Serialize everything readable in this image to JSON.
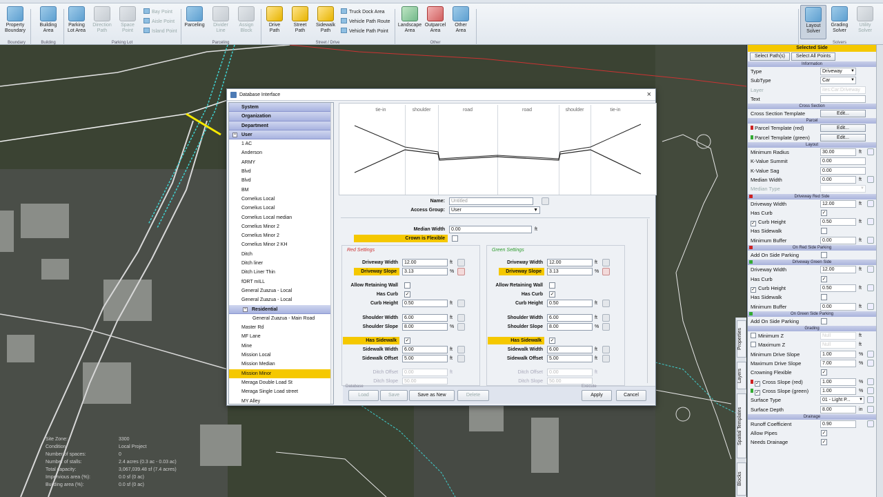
{
  "ribbon": {
    "buttons": [
      {
        "label": "Property\nBoundary",
        "state": "normal"
      },
      {
        "label": "Building\nArea",
        "state": "normal"
      },
      {
        "label": "Parking\nLot Area",
        "state": "normal"
      },
      {
        "label": "Direction\nPath",
        "state": "disabled"
      },
      {
        "label": "Space\nPoint",
        "state": "disabled"
      },
      {
        "label": "Parceling",
        "state": "normal"
      },
      {
        "label": "Divider\nLine",
        "state": "disabled"
      },
      {
        "label": "Assign\nBlock",
        "state": "disabled"
      },
      {
        "label": "Drive\nPath",
        "state": "yellow"
      },
      {
        "label": "Street\nPath",
        "state": "yellow"
      },
      {
        "label": "Sidewalk\nPath",
        "state": "yellow"
      },
      {
        "label": "Landscape\nArea",
        "state": "green"
      },
      {
        "label": "Outparcel\nArea",
        "state": "normal"
      },
      {
        "label": "Other\nArea",
        "state": "normal"
      },
      {
        "label": "Layout\nSolver",
        "state": "active"
      },
      {
        "label": "Grading\nSolver",
        "state": "normal"
      },
      {
        "label": "Utility\nSolver",
        "state": "disabled"
      }
    ],
    "small_left": [
      "Bay Point",
      "Aisle Point",
      "Island Point"
    ],
    "small_right": [
      "Truck Dock Area",
      "Vehicle Path Route",
      "Vehicle Path Point"
    ],
    "groups": [
      "Boundary",
      "Building",
      "Parking Lot",
      "Parceling",
      "Street / Drive",
      "Other",
      "Solvers"
    ]
  },
  "map": {
    "info_labels": [
      "Site Zone:",
      "Condition:",
      "Number of spaces:",
      "Number of stalls:",
      "Total capacity:",
      "Impervious area (%):",
      "Building area (%):"
    ],
    "info_values": [
      "3300",
      "Local Project",
      "0",
      "2.4 acres (0.3 ac - 0.03 ac)",
      "3,067,039.48 sf (7.4 acres)",
      "0.0 sf (0 ac)",
      "0.0 sf (0 ac)"
    ]
  },
  "dialog": {
    "title": "Database Interface",
    "close": "×",
    "tree": {
      "categories": [
        "System",
        "Organization",
        "Department",
        "User"
      ],
      "user_items": [
        "1 AC",
        "Anderson",
        "ARMY",
        "Blvd",
        "Blvd",
        "BM",
        "Cornelius Local",
        "Cornelius Local",
        "Cornelius Local median",
        "Cornelius Minor 2",
        "Cornelius Minor 2",
        "Cornelius Minor 2 KH",
        "Ditch",
        "Ditch liner",
        "Ditch Liner Thin",
        "fORT mILL",
        "General Zuazua - Local",
        "General Zuazua - Local"
      ],
      "subfolder": "Residential",
      "subfolder_items": [
        "General Zuazua - Main Road"
      ],
      "more_items": [
        "Master Rd",
        "MF Lane",
        "Mine",
        "Mission Local",
        "Mission Median",
        "Mission Minor",
        "Meraga Double Load St",
        "Meraga Single Load street",
        "MY Alley"
      ],
      "selected": "Mission Minor"
    },
    "preview": {
      "columns": [
        "tie-in",
        "shoulder",
        "road",
        "road",
        "shoulder",
        "tie-in"
      ]
    },
    "form": {
      "name_label": "Name:",
      "name_value": "Untitled",
      "group_label": "Access Group:",
      "group_value": "User",
      "median_label": "Median Width",
      "median_value": "0.00",
      "median_unit": "ft",
      "crown_label": "Crown is Flexible",
      "red_title": "Red Settings",
      "green_title": "Green Settings",
      "red": {
        "driveway_width": "12.00",
        "driveway_slope": "3.13",
        "curb_height": "0.50",
        "shoulder_width": "6.00",
        "shoulder_slope": "8.00",
        "sidewalk_width": "6.00",
        "sidewalk_offset": "5.00",
        "ditch_offset": "0.00",
        "ditch_slope": "50.00"
      },
      "green": {
        "driveway_width": "12.00",
        "driveway_slope": "3.13",
        "curb_height": "0.50",
        "shoulder_width": "6.00",
        "shoulder_slope": "8.00",
        "sidewalk_width": "6.00",
        "sidewalk_offset": "5.00",
        "ditch_offset": "0.00",
        "ditch_slope": "50.00"
      },
      "labels": {
        "driveway_width": "Driveway Width",
        "driveway_slope": "Driveway Slope",
        "allow_retaining": "Allow Retaining Wall",
        "has_curb": "Has Curb",
        "curb_height": "Curb Height",
        "shoulder_width": "Shoulder Width",
        "shoulder_slope": "Shoulder Slope",
        "has_sidewalk": "Has Sidewalk",
        "sidewalk_width": "Sidewalk Width",
        "sidewalk_offset": "Sidewalk Offset",
        "ditch_offset": "Ditch Offset",
        "ditch_slope": "Ditch Slope"
      },
      "units": {
        "ft": "ft",
        "pct": "%"
      }
    },
    "footer": {
      "load": "Load",
      "save": "Save",
      "save_as_new": "Save as New",
      "delete": "Delete",
      "apply": "Apply",
      "cancel": "Cancel",
      "database_label": "Database",
      "execute_label": "Execute"
    }
  },
  "panel": {
    "header": "Selected Side",
    "buttons": [
      "Select Path(s)",
      "Select All Points"
    ],
    "sections": {
      "information": "Information",
      "cross_section": "Cross Section",
      "parcel": "Parcel",
      "layout": "Layout",
      "red_side": "Driveway Red Side",
      "red_parking": "On Red Side Parking",
      "green_side": "Driveway Green Side",
      "green_parking": "On Green Side Parking",
      "grading": "Grading",
      "drainage": "Drainage"
    },
    "rows": {
      "type": "Type",
      "type_val": "Driveway",
      "subtype": "SubType",
      "subtype_val": "Car",
      "layer": "Layer",
      "layer_val": "ites:Car:Driveway",
      "text": "Text",
      "cst": "Cross Section Template",
      "edit": "Edit...",
      "ptred": "Parcel Template (red)",
      "ptgreen": "Parcel Template (green)",
      "minradius": "Minimum Radius",
      "minradius_val": "30.00",
      "kvs": "K-Value Summit",
      "kvs_val": "0.00",
      "kvsag": "K-Value Sag",
      "kvsag_val": "0.00",
      "median": "Median Width",
      "median_val": "0.00",
      "mediantype": "Median Type",
      "dw": "Driveway Width",
      "dw_val": "12.00",
      "hascurb": "Has Curb",
      "curbh": "Curb Height",
      "curbh_val": "0.50",
      "hassw": "Has Sidewalk",
      "minbuf": "Minimum Buffer",
      "minbuf_val": "0.00",
      "addpark": "Add On Side Parking",
      "minz": "Minimum Z",
      "maxz": "Maximum Z",
      "null": "Null",
      "minds": "Minimum Drive Slope",
      "minds_val": "1.00",
      "maxds": "Maximum Drive Slope",
      "maxds_val": "7.00",
      "crownflex": "Crowning Flexible",
      "xsred": "Cross Slope (red)",
      "xsred_val": "1.00",
      "xsgreen": "Cross Slope (green)",
      "xsgreen_val": "1.00",
      "surftype": "Surface Type",
      "surftype_val": "01 - Light P...",
      "surfdepth": "Surface Depth",
      "surfdepth_val": "8.00",
      "in": "in",
      "runoff": "Runoff Coefficient",
      "runoff_val": "0.90",
      "allowpipes": "Allow Pipes",
      "needsdrain": "Needs Drainage"
    },
    "vtabs": [
      "Properties",
      "Layers",
      "Spatial Templates",
      "Blocks"
    ]
  },
  "colors": {
    "accent": "#f5c800",
    "red": "#cc2222",
    "green": "#33aa33"
  }
}
